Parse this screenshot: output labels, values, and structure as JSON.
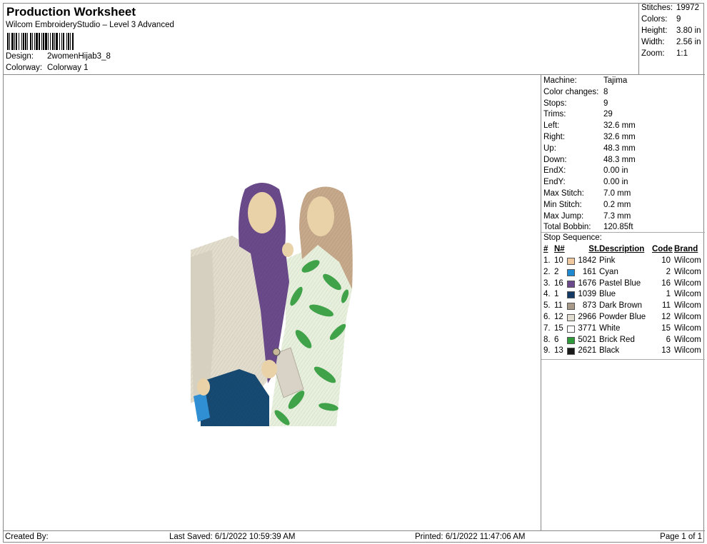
{
  "header": {
    "title": "Production Worksheet",
    "subtitle": "Wilcom EmbroideryStudio – Level 3 Advanced",
    "design_label": "Design:",
    "design_value": "2womenHijab3_8",
    "colorway_label": "Colorway:",
    "colorway_value": "Colorway 1"
  },
  "summary": [
    {
      "label": "Stitches:",
      "value": "19972"
    },
    {
      "label": "Colors:",
      "value": "9"
    },
    {
      "label": "Height:",
      "value": "3.80 in"
    },
    {
      "label": "Width:",
      "value": "2.56 in"
    },
    {
      "label": "Zoom:",
      "value": "1:1"
    }
  ],
  "specs": [
    {
      "label": "Machine:",
      "value": "Tajima"
    },
    {
      "label": "Color changes:",
      "value": "8"
    },
    {
      "label": "Stops:",
      "value": "9"
    },
    {
      "label": "Trims:",
      "value": "29"
    },
    {
      "label": "Left:",
      "value": "32.6 mm"
    },
    {
      "label": "Right:",
      "value": "32.6 mm"
    },
    {
      "label": "Up:",
      "value": "48.3 mm"
    },
    {
      "label": "Down:",
      "value": "48.3 mm"
    },
    {
      "label": "EndX:",
      "value": "0.00 in"
    },
    {
      "label": "EndY:",
      "value": "0.00 in"
    },
    {
      "label": "Max Stitch:",
      "value": "7.0 mm"
    },
    {
      "label": "Min Stitch:",
      "value": "0.2 mm"
    },
    {
      "label": "Max Jump:",
      "value": "7.3 mm"
    },
    {
      "label": "Total Bobbin:",
      "value": "120.85ft"
    }
  ],
  "stop_sequence": {
    "title": "Stop Sequence:",
    "columns": {
      "idx": "#",
      "n": "N#",
      "st": "St.",
      "desc": "Description",
      "code": "Code",
      "brand": "Brand"
    },
    "rows": [
      {
        "idx": "1.",
        "n": "10",
        "color": "#f0c8a0",
        "st": "1842",
        "desc": "Pink",
        "code": "10",
        "brand": "Wilcom"
      },
      {
        "idx": "2.",
        "n": "2",
        "color": "#1e88d0",
        "st": "161",
        "desc": "Cyan",
        "code": "2",
        "brand": "Wilcom"
      },
      {
        "idx": "3.",
        "n": "16",
        "color": "#6a4a8a",
        "st": "1676",
        "desc": "Pastel Blue",
        "code": "16",
        "brand": "Wilcom"
      },
      {
        "idx": "4.",
        "n": "1",
        "color": "#123a64",
        "st": "1039",
        "desc": "Blue",
        "code": "1",
        "brand": "Wilcom"
      },
      {
        "idx": "5.",
        "n": "11",
        "color": "#a89a88",
        "st": "873",
        "desc": "Dark Brown",
        "code": "11",
        "brand": "Wilcom"
      },
      {
        "idx": "6.",
        "n": "12",
        "color": "#e0ddd0",
        "st": "2966",
        "desc": "Powder Blue",
        "code": "12",
        "brand": "Wilcom"
      },
      {
        "idx": "7.",
        "n": "15",
        "color": "#ffffff",
        "st": "3771",
        "desc": "White",
        "code": "15",
        "brand": "Wilcom"
      },
      {
        "idx": "8.",
        "n": "6",
        "color": "#2e9a3a",
        "st": "5021",
        "desc": "Brick Red",
        "code": "6",
        "brand": "Wilcom"
      },
      {
        "idx": "9.",
        "n": "13",
        "color": "#1a1a1a",
        "st": "2621",
        "desc": "Black",
        "code": "13",
        "brand": "Wilcom"
      }
    ]
  },
  "footer": {
    "created_by": "Created By:",
    "last_saved": "Last Saved: 6/1/2022 10:59:39 AM",
    "printed": "Printed: 6/1/2022 11:47:06 AM",
    "page": "Page 1 of 1"
  }
}
